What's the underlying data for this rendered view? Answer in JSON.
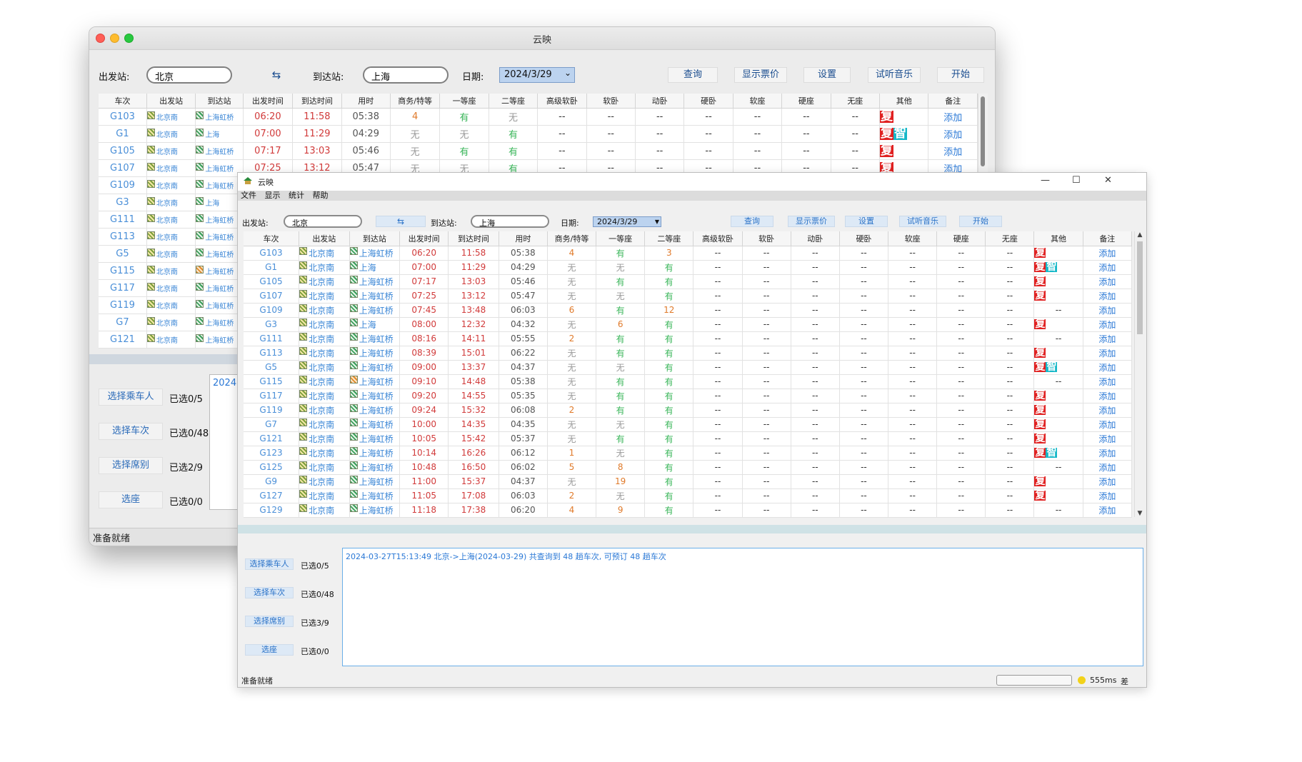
{
  "columns": [
    "车次",
    "出发站",
    "到达站",
    "出发时间",
    "到达时间",
    "用时",
    "商务/特等",
    "一等座",
    "二等座",
    "高级软卧",
    "软卧",
    "动卧",
    "硬卧",
    "软座",
    "硬座",
    "无座",
    "其他",
    "备注"
  ],
  "back_window": {
    "title": "云映",
    "from_label": "出发站:",
    "from_value": "北京",
    "swap_label": "⇆",
    "to_label": "到达站:",
    "to_value": "上海",
    "date_label": "日期:",
    "date_value": "2024/3/29",
    "buttons": {
      "query": "查询",
      "show_price": "显示票价",
      "settings": "设置",
      "music": "试听音乐",
      "start": "开始"
    },
    "rows": [
      [
        "G103",
        "北京南",
        "上海虹桥",
        "06:20",
        "11:58",
        "05:38",
        "4",
        "有",
        "无",
        "--",
        "--",
        "--",
        "--",
        "--",
        "--",
        "--",
        "复",
        "添加"
      ],
      [
        "G1",
        "北京南",
        "上海",
        "07:00",
        "11:29",
        "04:29",
        "无",
        "无",
        "有",
        "--",
        "--",
        "--",
        "--",
        "--",
        "--",
        "--",
        "复智",
        "添加"
      ],
      [
        "G105",
        "北京南",
        "上海虹桥",
        "07:17",
        "13:03",
        "05:46",
        "无",
        "有",
        "有",
        "--",
        "--",
        "--",
        "--",
        "--",
        "--",
        "--",
        "复",
        "添加"
      ],
      [
        "G107",
        "北京南",
        "上海虹桥",
        "07:25",
        "13:12",
        "05:47",
        "无",
        "无",
        "有",
        "--",
        "--",
        "--",
        "--",
        "--",
        "--",
        "--",
        "复",
        "添加"
      ],
      [
        "G109",
        "北京南",
        "上海虹桥",
        "",
        "",
        "",
        "",
        "",
        "",
        "",
        "",
        "",
        "",
        "",
        "",
        "",
        "",
        ""
      ],
      [
        "G3",
        "北京南",
        "上海",
        "",
        "",
        "",
        "",
        "",
        "",
        "",
        "",
        "",
        "",
        "",
        "",
        "",
        "",
        ""
      ],
      [
        "G111",
        "北京南",
        "上海虹桥",
        "",
        "",
        "",
        "",
        "",
        "",
        "",
        "",
        "",
        "",
        "",
        "",
        "",
        "",
        ""
      ],
      [
        "G113",
        "北京南",
        "上海虹桥",
        "",
        "",
        "",
        "",
        "",
        "",
        "",
        "",
        "",
        "",
        "",
        "",
        "",
        "",
        ""
      ],
      [
        "G5",
        "北京南",
        "上海虹桥",
        "",
        "",
        "",
        "",
        "",
        "",
        "",
        "",
        "",
        "",
        "",
        "",
        "",
        "",
        ""
      ],
      [
        "G115",
        "北京南",
        "上海虹桥",
        "",
        "",
        "",
        "",
        "",
        "",
        "",
        "",
        "",
        "",
        "",
        "",
        "",
        "",
        ""
      ],
      [
        "G117",
        "北京南",
        "上海虹桥",
        "",
        "",
        "",
        "",
        "",
        "",
        "",
        "",
        "",
        "",
        "",
        "",
        "",
        "",
        ""
      ],
      [
        "G119",
        "北京南",
        "上海虹桥",
        "",
        "",
        "",
        "",
        "",
        "",
        "",
        "",
        "",
        "",
        "",
        "",
        "",
        "",
        ""
      ],
      [
        "G7",
        "北京南",
        "上海虹桥",
        "",
        "",
        "",
        "",
        "",
        "",
        "",
        "",
        "",
        "",
        "",
        "",
        "",
        "",
        ""
      ],
      [
        "G121",
        "北京南",
        "上海虹桥",
        "",
        "",
        "",
        "",
        "",
        "",
        "",
        "",
        "",
        "",
        "",
        "",
        "",
        "",
        ""
      ]
    ],
    "left_buttons": [
      "选择乘车人",
      "选择车次",
      "选择席别",
      "选座"
    ],
    "left_counts": [
      "已选0/5",
      "已选0/48",
      "已选2/9",
      "已选0/0"
    ],
    "log_snippet": "2024",
    "status": "准备就绪"
  },
  "front_window": {
    "title": "云映",
    "menu": [
      "文件",
      "显示",
      "统计",
      "帮助"
    ],
    "controls": {
      "minimize": "—",
      "maximize": "☐",
      "close": "✕"
    },
    "from_label": "出发站:",
    "from_value": "北京",
    "swap_label": "⇆",
    "to_label": "到达站:",
    "to_value": "上海",
    "date_label": "日期:",
    "date_value": "2024/3/29",
    "buttons": {
      "query": "查询",
      "show_price": "显示票价",
      "settings": "设置",
      "music": "试听音乐",
      "start": "开始"
    },
    "rows": [
      [
        "G103",
        "北京南",
        "上海虹桥",
        "06:20",
        "11:58",
        "05:38",
        "4",
        "有",
        "3",
        "--",
        "--",
        "--",
        "--",
        "--",
        "--",
        "--",
        "复",
        "添加"
      ],
      [
        "G1",
        "北京南",
        "上海",
        "07:00",
        "11:29",
        "04:29",
        "无",
        "无",
        "有",
        "--",
        "--",
        "--",
        "--",
        "--",
        "--",
        "--",
        "复智",
        "添加"
      ],
      [
        "G105",
        "北京南",
        "上海虹桥",
        "07:17",
        "13:03",
        "05:46",
        "无",
        "有",
        "有",
        "--",
        "--",
        "--",
        "--",
        "--",
        "--",
        "--",
        "复",
        "添加"
      ],
      [
        "G107",
        "北京南",
        "上海虹桥",
        "07:25",
        "13:12",
        "05:47",
        "无",
        "无",
        "有",
        "--",
        "--",
        "--",
        "--",
        "--",
        "--",
        "--",
        "复",
        "添加"
      ],
      [
        "G109",
        "北京南",
        "上海虹桥",
        "07:45",
        "13:48",
        "06:03",
        "6",
        "有",
        "12",
        "--",
        "--",
        "--",
        "--",
        "--",
        "--",
        "--",
        "--",
        "添加"
      ],
      [
        "G3",
        "北京南",
        "上海",
        "08:00",
        "12:32",
        "04:32",
        "无",
        "6",
        "有",
        "--",
        "--",
        "--",
        "--",
        "--",
        "--",
        "--",
        "复",
        "添加"
      ],
      [
        "G111",
        "北京南",
        "上海虹桥",
        "08:16",
        "14:11",
        "05:55",
        "2",
        "有",
        "有",
        "--",
        "--",
        "--",
        "--",
        "--",
        "--",
        "--",
        "--",
        "添加"
      ],
      [
        "G113",
        "北京南",
        "上海虹桥",
        "08:39",
        "15:01",
        "06:22",
        "无",
        "有",
        "有",
        "--",
        "--",
        "--",
        "--",
        "--",
        "--",
        "--",
        "复",
        "添加"
      ],
      [
        "G5",
        "北京南",
        "上海虹桥",
        "09:00",
        "13:37",
        "04:37",
        "无",
        "无",
        "有",
        "--",
        "--",
        "--",
        "--",
        "--",
        "--",
        "--",
        "复智",
        "添加"
      ],
      [
        "G115",
        "北京南",
        "上海虹桥",
        "09:10",
        "14:48",
        "05:38",
        "无",
        "有",
        "有",
        "--",
        "--",
        "--",
        "--",
        "--",
        "--",
        "--",
        "--",
        "添加"
      ],
      [
        "G117",
        "北京南",
        "上海虹桥",
        "09:20",
        "14:55",
        "05:35",
        "无",
        "有",
        "有",
        "--",
        "--",
        "--",
        "--",
        "--",
        "--",
        "--",
        "复",
        "添加"
      ],
      [
        "G119",
        "北京南",
        "上海虹桥",
        "09:24",
        "15:32",
        "06:08",
        "2",
        "有",
        "有",
        "--",
        "--",
        "--",
        "--",
        "--",
        "--",
        "--",
        "复",
        "添加"
      ],
      [
        "G7",
        "北京南",
        "上海虹桥",
        "10:00",
        "14:35",
        "04:35",
        "无",
        "无",
        "有",
        "--",
        "--",
        "--",
        "--",
        "--",
        "--",
        "--",
        "复",
        "添加"
      ],
      [
        "G121",
        "北京南",
        "上海虹桥",
        "10:05",
        "15:42",
        "05:37",
        "无",
        "有",
        "有",
        "--",
        "--",
        "--",
        "--",
        "--",
        "--",
        "--",
        "复",
        "添加"
      ],
      [
        "G123",
        "北京南",
        "上海虹桥",
        "10:14",
        "16:26",
        "06:12",
        "1",
        "无",
        "有",
        "--",
        "--",
        "--",
        "--",
        "--",
        "--",
        "--",
        "复智",
        "添加"
      ],
      [
        "G125",
        "北京南",
        "上海虹桥",
        "10:48",
        "16:50",
        "06:02",
        "5",
        "8",
        "有",
        "--",
        "--",
        "--",
        "--",
        "--",
        "--",
        "--",
        "--",
        "添加"
      ],
      [
        "G9",
        "北京南",
        "上海虹桥",
        "11:00",
        "15:37",
        "04:37",
        "无",
        "19",
        "有",
        "--",
        "--",
        "--",
        "--",
        "--",
        "--",
        "--",
        "复",
        "添加"
      ],
      [
        "G127",
        "北京南",
        "上海虹桥",
        "11:05",
        "17:08",
        "06:03",
        "2",
        "无",
        "有",
        "--",
        "--",
        "--",
        "--",
        "--",
        "--",
        "--",
        "复",
        "添加"
      ],
      [
        "G129",
        "北京南",
        "上海虹桥",
        "11:18",
        "17:38",
        "06:20",
        "4",
        "9",
        "有",
        "--",
        "--",
        "--",
        "--",
        "--",
        "--",
        "--",
        "--",
        "添加"
      ]
    ],
    "left_buttons": [
      "选择乘车人",
      "选择车次",
      "选择席别",
      "选座"
    ],
    "left_counts": [
      "已选0/5",
      "已选0/48",
      "已选3/9",
      "已选0/0"
    ],
    "log": "2024-03-27T15:13:49 北京->上海(2024-03-29) 共查询到 48 趟车次, 可预订 48 趟车次",
    "status": "准备就绪",
    "latency": "555ms",
    "latency_suffix": "差"
  }
}
